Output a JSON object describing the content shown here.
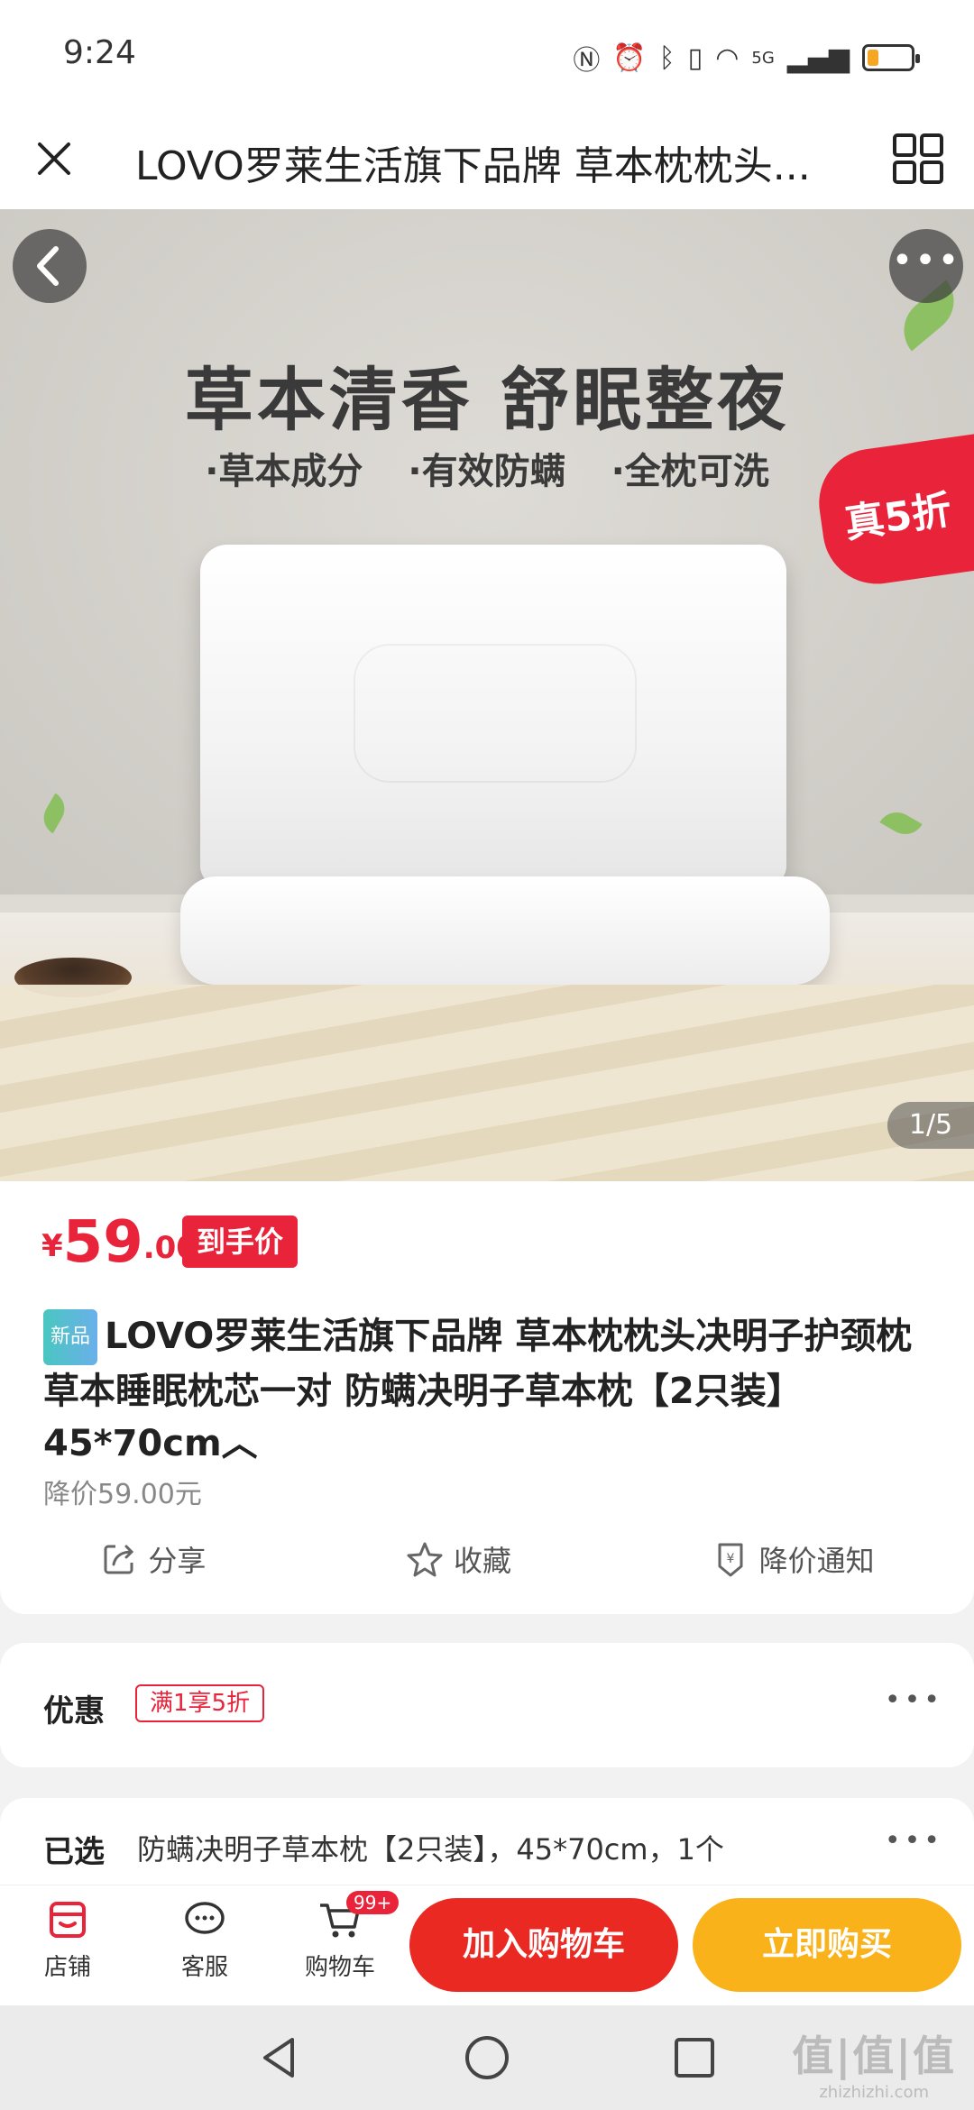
{
  "status_bar": {
    "time": "9:24",
    "network": "5G"
  },
  "nav": {
    "title": "LOVO罗莱生活旗下品牌 草本枕枕头..."
  },
  "hero": {
    "headline": "草本清香 舒眠整夜",
    "features": [
      "·草本成分",
      "·有效防螨",
      "·全枕可洗"
    ],
    "discount_badge": "真5折",
    "image_counter": "1/5"
  },
  "price": {
    "symbol": "¥",
    "integer": "59",
    "decimal": ".00",
    "tag": "到手价"
  },
  "product": {
    "new_badge": "新品",
    "title": "LOVO罗莱生活旗下品牌 草本枕枕头决明子护颈枕草本睡眠枕芯一对 防螨决明子草本枕【2只装】 45*70cm︿",
    "price_drop": "降价59.00元"
  },
  "actions": {
    "share": "分享",
    "favorite": "收藏",
    "price_alert": "降价通知"
  },
  "coupon": {
    "label": "优惠",
    "tag": "满1享5折",
    "more": "•••"
  },
  "selected": {
    "label": "已选",
    "value": "防螨决明子草本枕【2只装】，45*70cm，1个",
    "more": "•••"
  },
  "bottom_bar": {
    "store": "店铺",
    "service": "客服",
    "cart": "购物车",
    "cart_badge": "99+",
    "add_to_cart": "加入购物车",
    "buy_now": "立即购买"
  },
  "watermark": {
    "big": "值|值|值",
    "small": "zhizhizhi.com"
  },
  "colors": {
    "accent_red": "#e8233a",
    "buy_yellow": "#f9b21a",
    "cart_red": "#ea2a22"
  },
  "battery_level": 0.25
}
